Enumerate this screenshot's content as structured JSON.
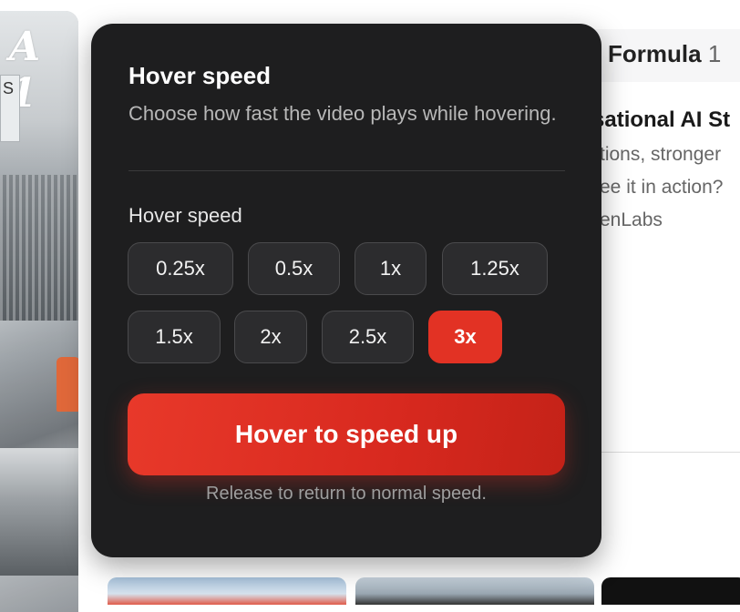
{
  "background": {
    "stand_text": "A 1",
    "sign_text": "S",
    "heading": {
      "text": "Formula",
      "number": "1"
    },
    "article_title": "sational AI St",
    "article_lines": [
      "tions, stronger",
      "ee it in action?",
      "enLabs"
    ]
  },
  "popover": {
    "title": "Hover speed",
    "description": "Choose how fast the video plays while hovering.",
    "section_label": "Hover speed",
    "speeds": [
      "0.25x",
      "0.5x",
      "1x",
      "1.25x",
      "1.5x",
      "2x",
      "2.5x",
      "3x"
    ],
    "selected_speed": "3x",
    "action_button": "Hover to speed up",
    "hint": "Release to return to normal speed."
  },
  "colors": {
    "accent": "#e23224",
    "panel": "#1e1e1f",
    "button": "#2c2c2e"
  }
}
